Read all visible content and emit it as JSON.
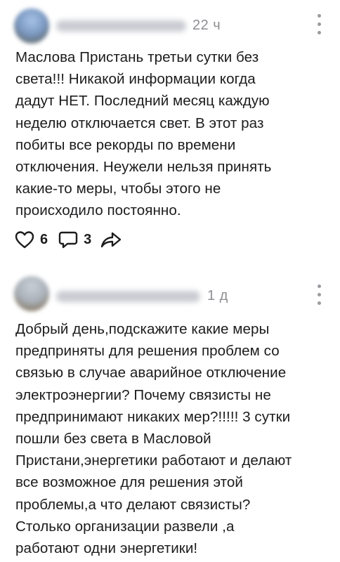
{
  "comments": [
    {
      "time": "22 ч",
      "text": "Маслова Пристань третьи сутки без\nсвета!!! Никакой информации когда\nдадут НЕТ. Последний месяц каждую\nнеделю отключается свет. В этот раз\nпобиты все рекорды по времени\nотключения. Неужели нельзя принять\nкакие-то меры, чтобы этого не\nпроисходило постоянно.",
      "likes": "6",
      "replies": "3"
    },
    {
      "time": "1 д",
      "text": "Добрый день,подскажите какие меры\nпредприняты для решения проблем со\nсвязью в случае аварийное отключение\nэлектроэнергии? Почему связисты не\nпредпринимают никаких мер?!!!!! 3 сутки\nпошли без света в Масловой\nПристани,энергетики работают и делают\nвсе возможное для решения этой\nпроблемы,а что делают связисты?\nСтолько организации развели ,а\nработают одни энергетики!"
    }
  ],
  "icons": {
    "like": "heart-outline-icon",
    "reply": "speech-bubble-icon",
    "share": "share-arrow-icon",
    "more": "more-vertical-icon"
  }
}
